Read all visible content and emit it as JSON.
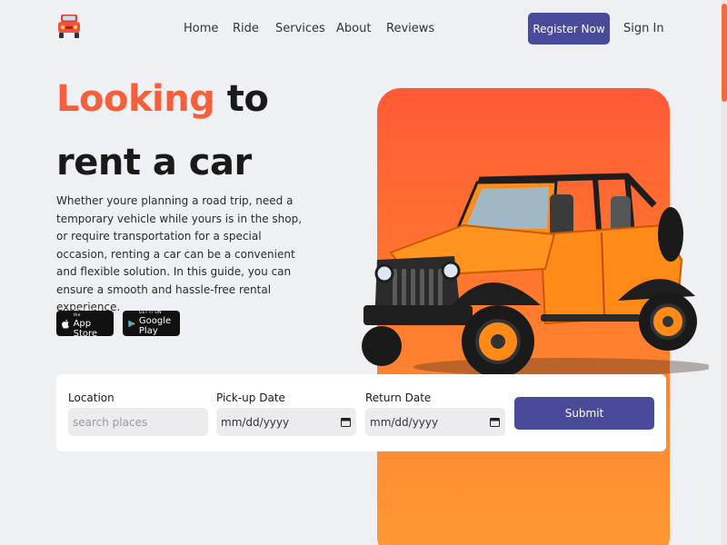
{
  "nav": {
    "items": [
      "Home",
      "Ride",
      "Services",
      "About",
      "Reviews"
    ],
    "register_label": "Register Now",
    "signin_label": "Sign In"
  },
  "hero": {
    "headline_accent": "Looking",
    "headline_rest": " to",
    "headline_line2": "rent a car",
    "description": "Whether youre planning a road trip, need a temporary vehicle while yours is in the shop, or require transportation for a special occasion, renting a car can be a convenient and flexible solution. In this guide, you can ensure a smooth and hassle-free rental experience."
  },
  "badges": {
    "apple_small": "Download on the",
    "apple_big": "App Store",
    "google_small": "GET IT ON",
    "google_big": "Google Play"
  },
  "form": {
    "location_label": "Location",
    "location_placeholder": "search places",
    "pickup_label": "Pick-up Date",
    "pickup_value": "mm/dd/yyyy",
    "return_label": "Return Date",
    "return_value": "mm/dd/yyyy",
    "submit_label": "Submit"
  },
  "colors": {
    "accent": "#f55f3b",
    "primary_button": "#4a4a9b",
    "panel_top": "#ff5a36",
    "panel_bottom": "#ff9a35",
    "background": "#eef0f3"
  }
}
